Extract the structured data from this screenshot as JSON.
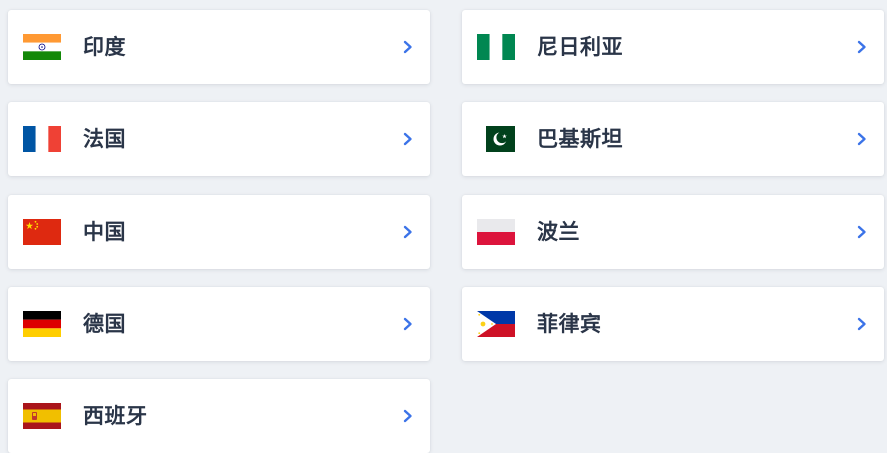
{
  "countries": [
    {
      "name": "印度",
      "flag": "india-flag-icon"
    },
    {
      "name": "尼日利亚",
      "flag": "nigeria-flag-icon"
    },
    {
      "name": "法国",
      "flag": "france-flag-icon"
    },
    {
      "name": "巴基斯坦",
      "flag": "pakistan-flag-icon"
    },
    {
      "name": "中国",
      "flag": "china-flag-icon"
    },
    {
      "name": "波兰",
      "flag": "poland-flag-icon"
    },
    {
      "name": "德国",
      "flag": "germany-flag-icon"
    },
    {
      "name": "菲律宾",
      "flag": "philippines-flag-icon"
    },
    {
      "name": "西班牙",
      "flag": "spain-flag-icon"
    }
  ],
  "icons": {
    "chevron": "chevron-right-icon"
  },
  "colors": {
    "page_background": "#eef1f5",
    "card_background": "#ffffff",
    "label_text": "#2a3548",
    "chevron": "#3b73e8"
  }
}
